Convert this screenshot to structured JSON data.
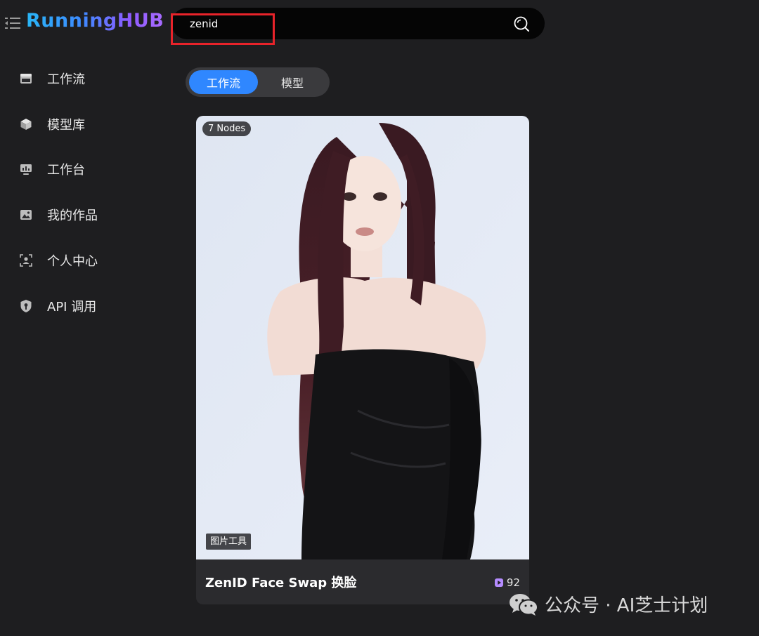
{
  "header": {
    "logo_text": "RunningHUB",
    "search": {
      "value": "zenid"
    }
  },
  "sidebar": {
    "items": [
      {
        "label": "工作流",
        "icon": "workflow-icon"
      },
      {
        "label": "模型库",
        "icon": "model-library-icon"
      },
      {
        "label": "工作台",
        "icon": "workbench-icon"
      },
      {
        "label": "我的作品",
        "icon": "my-works-icon"
      },
      {
        "label": "个人中心",
        "icon": "profile-icon"
      },
      {
        "label": "API 调用",
        "icon": "api-icon"
      }
    ]
  },
  "tabs": [
    {
      "label": "工作流",
      "active": true
    },
    {
      "label": "模型",
      "active": false
    }
  ],
  "results": [
    {
      "nodes_badge": "7 Nodes",
      "category_tag": "图片工具",
      "title": "ZenID Face Swap 换脸",
      "run_count": "92"
    }
  ],
  "watermark": {
    "text": "公众号 · AI芝士计划"
  },
  "colors": {
    "background": "#1e1e20",
    "accent": "#2f87ff",
    "highlight_box": "#e8232a",
    "play_icon": "#b58cff"
  }
}
